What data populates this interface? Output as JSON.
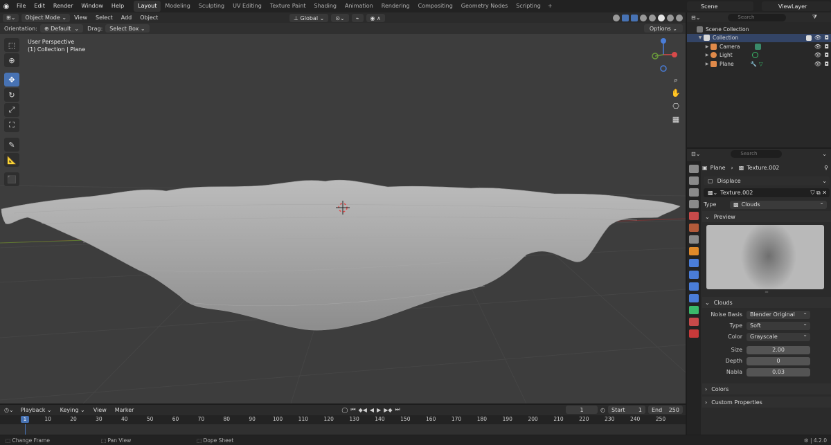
{
  "topbar": {
    "menu": [
      "File",
      "Edit",
      "Render",
      "Window",
      "Help"
    ],
    "workspaces": [
      "Layout",
      "Modeling",
      "Sculpting",
      "UV Editing",
      "Texture Paint",
      "Shading",
      "Animation",
      "Rendering",
      "Compositing",
      "Geometry Nodes",
      "Scripting"
    ],
    "active_workspace": "Layout",
    "scene": "Scene",
    "view_layer": "ViewLayer"
  },
  "viewport": {
    "mode": "Object Mode",
    "menu": [
      "View",
      "Select",
      "Add",
      "Object"
    ],
    "orientation_label": "Orientation:",
    "orientation_value": "Default",
    "drag_label": "Drag:",
    "drag_value": "Select Box",
    "transform_space": "Global",
    "options": "Options",
    "perspective": "User Perspective",
    "collection_info": "(1) Collection | Plane"
  },
  "outliner": {
    "search_placeholder": "Search",
    "items": [
      {
        "label": "Scene Collection",
        "level": 0
      },
      {
        "label": "Collection",
        "level": 1
      },
      {
        "label": "Camera",
        "level": 2
      },
      {
        "label": "Light",
        "level": 2
      },
      {
        "label": "Plane",
        "level": 2
      }
    ]
  },
  "properties": {
    "search_placeholder": "Search",
    "breadcrumb_object": "Plane",
    "breadcrumb_texture": "Texture.002",
    "modifier": "Displace",
    "texture_name": "Texture.002",
    "type_label": "Type",
    "type_value": "Clouds",
    "preview_label": "Preview",
    "clouds_label": "Clouds",
    "noise_basis_label": "Noise Basis",
    "noise_basis_value": "Blender Original",
    "cloud_type_label": "Type",
    "cloud_type_value": "Soft",
    "color_label": "Color",
    "color_value": "Grayscale",
    "size_label": "Size",
    "size_value": "2.00",
    "depth_label": "Depth",
    "depth_value": "0",
    "nabla_label": "Nabla",
    "nabla_value": "0.03",
    "colors_panel": "Colors",
    "custom_props_panel": "Custom Properties"
  },
  "timeline": {
    "menu": [
      "Playback",
      "Keying",
      "View",
      "Marker"
    ],
    "current_frame": "1",
    "start_label": "Start",
    "start_value": "1",
    "end_label": "End",
    "end_value": "250",
    "ticks": [
      "1",
      "10",
      "20",
      "30",
      "40",
      "50",
      "60",
      "70",
      "80",
      "90",
      "100",
      "110",
      "120",
      "130",
      "140",
      "150",
      "160",
      "170",
      "180",
      "190",
      "200",
      "210",
      "220",
      "230",
      "240",
      "250"
    ]
  },
  "statusbar": {
    "items": [
      "Change Frame",
      "Pan View",
      "Dope Sheet"
    ],
    "version": "4.2.0"
  }
}
